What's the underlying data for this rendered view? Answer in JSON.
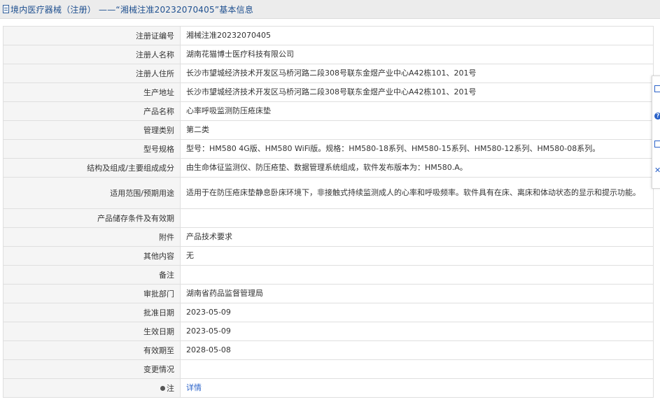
{
  "header": {
    "title": "境内医疗器械（注册） ——“湘械注准20232070405”基本信息"
  },
  "rows": [
    {
      "label": "注册证编号",
      "value": "湘械注准20232070405"
    },
    {
      "label": "注册人名称",
      "value": "湖南花猫博士医疗科技有限公司"
    },
    {
      "label": "注册人住所",
      "value": "长沙市望城经济技术开发区马桥河路二段308号联东金煜产业中心A42栋101、201号"
    },
    {
      "label": "生产地址",
      "value": "长沙市望城经济技术开发区马桥河路二段308号联东金煜产业中心A42栋101、201号"
    },
    {
      "label": "产品名称",
      "value": "心率呼吸监测防压疮床垫"
    },
    {
      "label": "管理类别",
      "value": "第二类"
    },
    {
      "label": "型号规格",
      "value": "型号：HM580 4G版、HM580 WiFi版。规格：HM580-18系列、HM580-15系列、HM580-12系列、HM580-08系列。"
    },
    {
      "label": "结构及组成/主要组成成分",
      "value": "由生命体征监测仪、防压疮垫、数据管理系统组成，软件发布版本为：HM580.A。"
    },
    {
      "label": "适用范围/预期用途",
      "value": "适用于在防压疮床垫静息卧床环境下，非接触式持续监测成人的心率和呼吸频率。软件具有在床、离床和体动状态的显示和提示功能。"
    },
    {
      "label": "产品储存条件及有效期",
      "value": ""
    },
    {
      "label": "附件",
      "value": "产品技术要求"
    },
    {
      "label": "其他内容",
      "value": "无"
    },
    {
      "label": "备注",
      "value": ""
    },
    {
      "label": "审批部门",
      "value": "湖南省药品监督管理局"
    },
    {
      "label": "批准日期",
      "value": "2023-05-09"
    },
    {
      "label": "生效日期",
      "value": "2023-05-09"
    },
    {
      "label": "有效期至",
      "value": "2028-05-08"
    },
    {
      "label": "变更情况",
      "value": ""
    },
    {
      "label": "注",
      "value": "详情"
    }
  ],
  "side_tools": [
    "edit-icon",
    "help-icon",
    "copy-icon",
    "close-icon"
  ],
  "colors": {
    "title": "#1e4f8f",
    "link": "#2a62c9",
    "label_bg": "#f5f5f5",
    "border": "#dfdfdf"
  }
}
